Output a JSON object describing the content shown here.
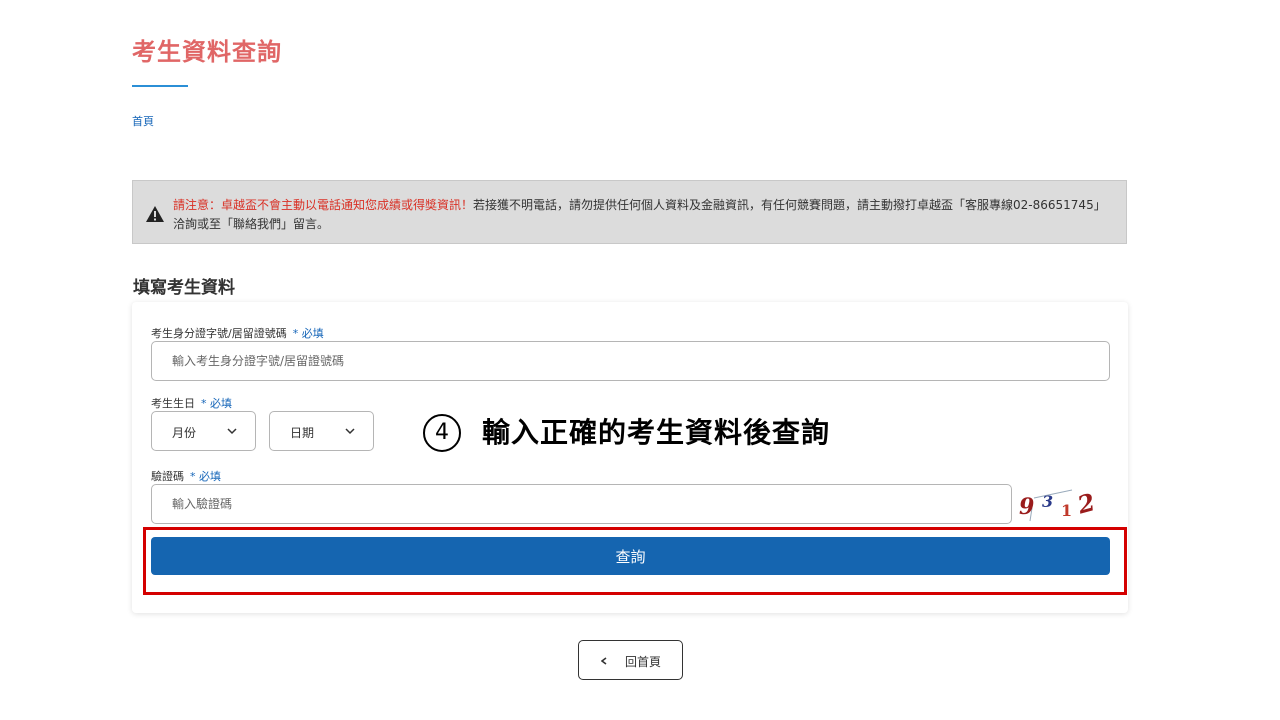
{
  "page": {
    "title": "考生資料查詢",
    "breadcrumb": "首頁"
  },
  "notice": {
    "warning": "請注意：卓越盃不會主動以電話通知您成績或得獎資訊！",
    "body": "若接獲不明電話，請勿提供任何個人資料及金融資訊，有任何競賽問題，請主動撥打卓越盃「客服專線02-86651745」洽詢或至「聯絡我們」留言。",
    "icon": "warning-triangle-icon"
  },
  "form": {
    "section_title": "填寫考生資料",
    "required_mark": "* 必填",
    "id_field": {
      "label": "考生身分證字號/居留證號碼",
      "placeholder": "輸入考生身分證字號/居留證號碼"
    },
    "birthday": {
      "label": "考生生日",
      "month_value": "月份",
      "day_value": "日期"
    },
    "captcha": {
      "label": "驗證碼",
      "placeholder": "輸入驗證碼",
      "image_text": "9312"
    },
    "submit_label": "查詢"
  },
  "annotation": {
    "step_number": "4",
    "text": "輸入正確的考生資料後查詢",
    "highlight_color": "#d40000"
  },
  "back_button": {
    "label": "回首頁"
  },
  "colors": {
    "title": "#e06666",
    "accent_blue": "#1565b0",
    "notice_bg": "#dcdcdc",
    "warning_red": "#d93025"
  }
}
